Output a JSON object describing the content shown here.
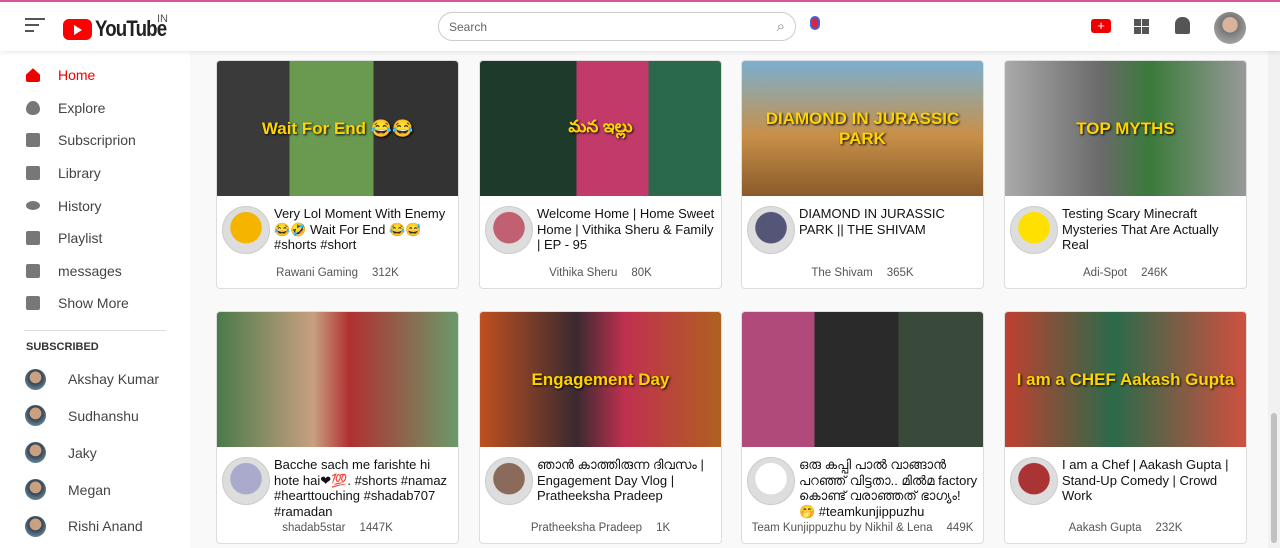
{
  "header": {
    "logo": "YouTube",
    "country": "IN",
    "search_placeholder": "Search"
  },
  "sidebar": {
    "items": [
      {
        "label": "Home",
        "active": true
      },
      {
        "label": "Explore"
      },
      {
        "label": "Subscriprion"
      },
      {
        "label": "Library"
      },
      {
        "label": "History"
      },
      {
        "label": "Playlist"
      },
      {
        "label": "messages"
      },
      {
        "label": "Show More"
      }
    ],
    "subscribed_heading": "SUBSCRIBED",
    "subscriptions": [
      "Akshay Kumar",
      "Sudhanshu",
      "Jaky",
      "Megan",
      "Rishi Anand"
    ]
  },
  "videos": [
    {
      "title": "Very Lol Moment With Enemy 😂🤣 Wait For End 😂😅 #shorts #short",
      "channel": "Rawani Gaming",
      "views": "312K",
      "overlay": "Wait For End 😂😂"
    },
    {
      "title": "Welcome Home | Home Sweet Home | Vithika Sheru & Family | EP - 95",
      "channel": "Vithika Sheru",
      "views": "80K",
      "overlay": "మన ఇల్లు"
    },
    {
      "title": "DIAMOND IN JURASSIC PARK || THE SHIVAM",
      "channel": "The Shivam",
      "views": "365K",
      "overlay": "DIAMOND IN JURASSIC PARK"
    },
    {
      "title": "Testing Scary Minecraft Mysteries That Are Actually Real",
      "channel": "Adi-Spot",
      "views": "246K",
      "overlay": "TOP MYTHS"
    },
    {
      "title": "Bacche sach me farishte hi hote hai❤💯. #shorts #namaz #hearttouching #shadab707 #ramadan",
      "channel": "shadab5star",
      "views": "1447K",
      "overlay": ""
    },
    {
      "title": "ഞാൻ കാത്തിരുന്ന ദിവസം | Engagement Day Vlog | Pratheeksha Pradeep",
      "channel": "Pratheeksha Pradeep",
      "views": "1K",
      "overlay": "Engagement Day"
    },
    {
      "title": "ഒരു കപ്പി പാൽ വാങ്ങാൻ പറഞ്ഞ് വിട്ടതാ.. മിൽമ factory കൊണ്ട് വരാഞ്ഞത് ഭാഗ്യം! 🤭 #teamkunjippuzhu",
      "channel": "Team Kunjippuzhu by Nikhil & Lena",
      "views": "449K",
      "overlay": ""
    },
    {
      "title": "I am a Chef | Aakash Gupta | Stand-Up Comedy | Crowd Work",
      "channel": "Aakash Gupta",
      "views": "232K",
      "overlay": "I am a CHEF Aakash Gupta"
    }
  ]
}
